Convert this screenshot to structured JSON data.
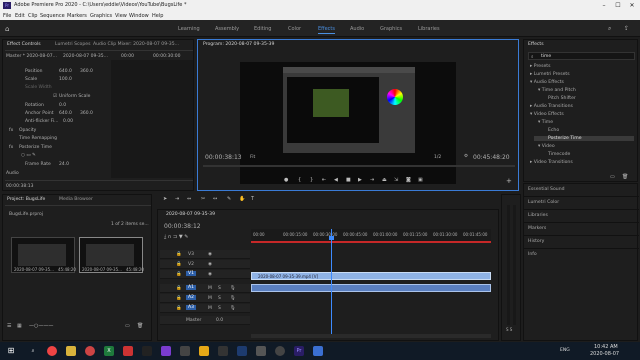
{
  "window": {
    "title": "Adobe Premiere Pro 2020 - C:\\Users\\eddie\\Videos\\YouTube\\BugsLife *"
  },
  "menu": [
    "File",
    "Edit",
    "Clip",
    "Sequence",
    "Markers",
    "Graphics",
    "View",
    "Window",
    "Help"
  ],
  "workspaces": [
    "Learning",
    "Assembly",
    "Editing",
    "Color",
    "Effects",
    "Audio",
    "Graphics",
    "Libraries"
  ],
  "active_workspace": "Effects",
  "effect_controls": {
    "tabs": [
      "Effect Controls",
      "Lumetri Scopes",
      "Audio Clip Mixer: 2020-08-07 09-35..."
    ],
    "master": "Master * 2020-08-07...",
    "clip": "2020-08-07 09-35...",
    "time_marks": [
      "00:00",
      "00:00:30:00"
    ],
    "rows": [
      {
        "label": "Position",
        "v1": "640.0",
        "v2": "360.0"
      },
      {
        "label": "Scale",
        "v1": "100.0",
        "v2": ""
      },
      {
        "label": "Scale Width",
        "v1": "",
        "v2": ""
      },
      {
        "label": "Uniform Scale",
        "v1": "",
        "v2": ""
      },
      {
        "label": "Rotation",
        "v1": "0.0",
        "v2": ""
      },
      {
        "label": "Anchor Point",
        "v1": "640.0",
        "v2": "360.0"
      },
      {
        "label": "Anti-flicker Fi...",
        "v1": "0.00",
        "v2": ""
      },
      {
        "label": "Opacity",
        "v1": "",
        "v2": ""
      },
      {
        "label": "Time Remapping",
        "v1": "",
        "v2": ""
      },
      {
        "label": "Posterize Time",
        "v1": "",
        "v2": ""
      },
      {
        "label": "Frame Rate",
        "v1": "24.0",
        "v2": ""
      }
    ],
    "audio_label": "Audio",
    "timecode": "00:00:38:13"
  },
  "program": {
    "tab": "Program: 2020-08-07 09-35-39",
    "timecode_left": "00:00:38:13",
    "fit": "Fit",
    "ratio": "1/2",
    "timecode_right": "00:45:48:20"
  },
  "effects_panel": {
    "title": "Effects",
    "search": "time",
    "tree": [
      {
        "label": "Presets",
        "indent": 0
      },
      {
        "label": "Lumetri Presets",
        "indent": 0
      },
      {
        "label": "Audio Effects",
        "indent": 0
      },
      {
        "label": "Time and Pitch",
        "indent": 1
      },
      {
        "label": "Pitch Shifter",
        "indent": 2
      },
      {
        "label": "Audio Transitions",
        "indent": 0
      },
      {
        "label": "Video Effects",
        "indent": 0
      },
      {
        "label": "Time",
        "indent": 1
      },
      {
        "label": "Echo",
        "indent": 2
      },
      {
        "label": "Posterize Time",
        "indent": 2
      },
      {
        "label": "Video",
        "indent": 1
      },
      {
        "label": "Timecode",
        "indent": 2
      },
      {
        "label": "Video Transitions",
        "indent": 0
      }
    ],
    "selected": "Posterize Time",
    "side_panels": [
      "Essential Sound",
      "Lumetri Color",
      "Libraries",
      "Markers",
      "History",
      "Info"
    ]
  },
  "project": {
    "tabs": [
      "Project: BugsLife",
      "Media Browser"
    ],
    "file": "BugsLife.prproj",
    "selection": "1 of 2 items se...",
    "thumbs": [
      {
        "name": "2020-08-07 09-35...",
        "dur": "45:48:20"
      },
      {
        "name": "2020-08-07 09-35...",
        "dur": "45:48:20"
      }
    ]
  },
  "timeline": {
    "tab": "2020-08-07 09-35-39",
    "timecode": "00:00:38:12",
    "ruler": [
      "00:00",
      "00:00:15:00",
      "00:00:30:00",
      "00:00:45:00",
      "00:01:00:00",
      "00:01:15:00",
      "00:01:30:00",
      "00:01:45:00"
    ],
    "video_tracks": [
      "V3",
      "V2",
      "V1"
    ],
    "audio_tracks": [
      "A1",
      "A2",
      "A3"
    ],
    "clip_label": "2020-08-07 09-35-39.mp4 [V]",
    "master_label": "Master",
    "master_value": "0.0",
    "meter_label": "S S"
  },
  "taskbar": {
    "time": "10:42 AM",
    "date": "2020-08-07",
    "lang": "ENG"
  }
}
